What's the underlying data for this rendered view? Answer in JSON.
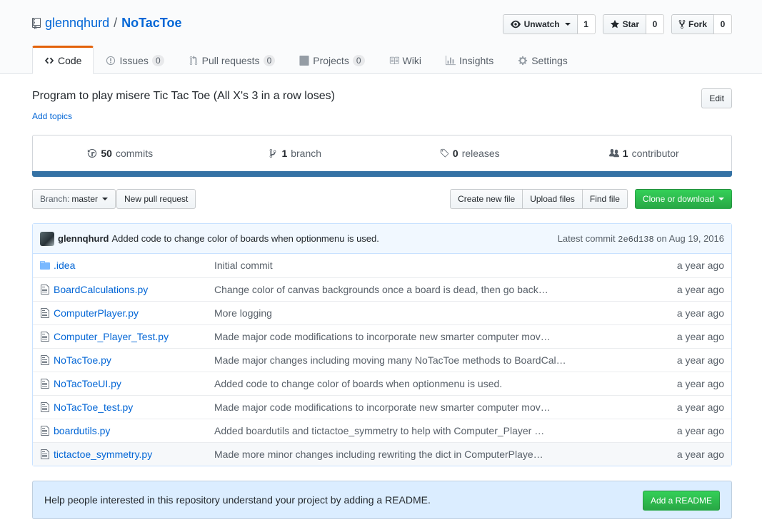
{
  "repo": {
    "owner": "glennqhurd",
    "separator": "/",
    "name": "NoTacToe"
  },
  "actions": {
    "watch": {
      "label": "Unwatch",
      "count": "1"
    },
    "star": {
      "label": "Star",
      "count": "0"
    },
    "fork": {
      "label": "Fork",
      "count": "0"
    }
  },
  "tabs": [
    {
      "label": "Code",
      "counter": ""
    },
    {
      "label": "Issues",
      "counter": "0"
    },
    {
      "label": "Pull requests",
      "counter": "0"
    },
    {
      "label": "Projects",
      "counter": "0"
    },
    {
      "label": "Wiki",
      "counter": ""
    },
    {
      "label": "Insights",
      "counter": ""
    },
    {
      "label": "Settings",
      "counter": ""
    }
  ],
  "description": "Program to play misere Tic Tac Toe (All X's 3 in a row loses)",
  "add_topics": "Add topics",
  "edit_label": "Edit",
  "summary": {
    "commits": {
      "count": "50",
      "label": "commits"
    },
    "branches": {
      "count": "1",
      "label": "branch"
    },
    "releases": {
      "count": "0",
      "label": "releases"
    },
    "contributors": {
      "count": "1",
      "label": "contributor"
    }
  },
  "language_color": "#3572a5",
  "branch": {
    "label": "Branch:",
    "value": "master"
  },
  "new_pr_label": "New pull request",
  "file_buttons": {
    "create": "Create new file",
    "upload": "Upload files",
    "find": "Find file",
    "clone": "Clone or download"
  },
  "latest_commit": {
    "author": "glennqhurd",
    "message": "Added code to change color of boards when optionmenu is used.",
    "prefix": "Latest commit",
    "sha": "2e6d138",
    "date": "on Aug 19, 2016"
  },
  "files": [
    {
      "type": "dir",
      "name": ".idea",
      "message": "Initial commit",
      "age": "a year ago"
    },
    {
      "type": "file",
      "name": "BoardCalculations.py",
      "message": "Change color of canvas backgrounds once a board is dead, then go back…",
      "age": "a year ago"
    },
    {
      "type": "file",
      "name": "ComputerPlayer.py",
      "message": "More logging",
      "age": "a year ago"
    },
    {
      "type": "file",
      "name": "Computer_Player_Test.py",
      "message": "Made major code modifications to incorporate new smarter computer mov…",
      "age": "a year ago"
    },
    {
      "type": "file",
      "name": "NoTacToe.py",
      "message": "Made major changes including moving many NoTacToe methods to BoardCal…",
      "age": "a year ago"
    },
    {
      "type": "file",
      "name": "NoTacToeUI.py",
      "message": "Added code to change color of boards when optionmenu is used.",
      "age": "a year ago"
    },
    {
      "type": "file",
      "name": "NoTacToe_test.py",
      "message": "Made major code modifications to incorporate new smarter computer mov…",
      "age": "a year ago"
    },
    {
      "type": "file",
      "name": "boardutils.py",
      "message": "Added boardutils and tictactoe_symmetry to help with Computer_Player …",
      "age": "a year ago"
    },
    {
      "type": "file",
      "name": "tictactoe_symmetry.py",
      "message": "Made more minor changes including rewriting the dict in ComputerPlaye…",
      "age": "a year ago"
    }
  ],
  "readme": {
    "message": "Help people interested in this repository understand your project by adding a README.",
    "button": "Add a README"
  }
}
